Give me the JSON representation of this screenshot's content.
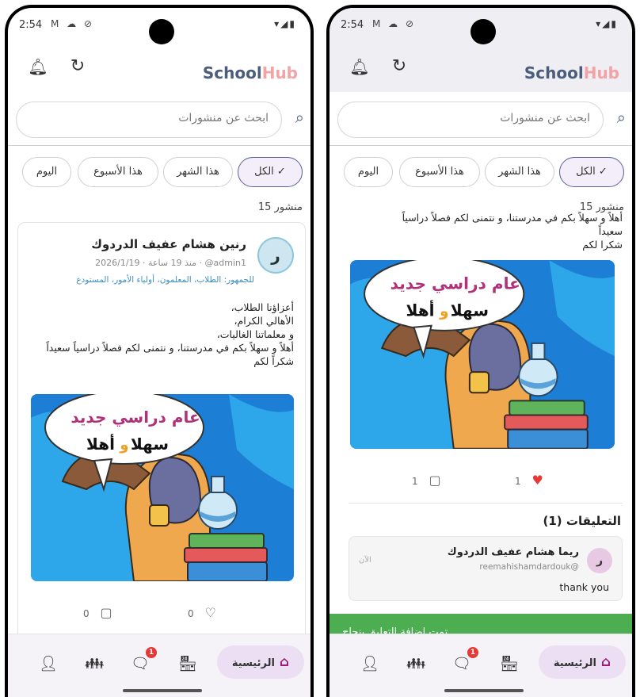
{
  "status_bar": {
    "time": "2:54",
    "left_icons": "M ☁ ⊘",
    "right_icons": "▾◢▮"
  },
  "header": {
    "brand_part1": "School",
    "brand_part2": "Hub"
  },
  "search": {
    "placeholder": "ابحث عن منشورات"
  },
  "filters": {
    "all": "الكل ✓",
    "month": "هذا الشهر",
    "week": "هذا الأسبوع",
    "today": "اليوم"
  },
  "post_count": "منشور 15",
  "post": {
    "avatar_letter": "ر",
    "author": "رنين هشام عفيف الدردوك",
    "meta": "admin1@ · منذ 19 ساعة · 2026/1/19",
    "audience": "للجمهور: الطلاب، المعلمون، أولياء الأمور، المستودع",
    "body_lines": [
      "أعزاؤنا الطلاب،",
      "الأهالي الكرام،",
      "و معلماتنا الغاليات،",
      "أهلاً و سهلاً بكم في مدرستنا، و نتمنى لكم فصلاً دراسياً سعيداً",
      "شكراً لكم"
    ],
    "image_title": "عام دراسي جديد",
    "image_greeting_1": "أهلا",
    "image_greeting_and": "و",
    "image_greeting_2": "سهلا",
    "comments_count_left": "0",
    "likes_count_left": "0",
    "comments_count_right": "1",
    "likes_count_right": "1"
  },
  "right_screen": {
    "cut_text_line1": "أهلاً و سهلاً بكم في مدرستنا، و نتمنى لكم فصلاً دراسياً",
    "cut_text_line2": "سعيداً",
    "cut_text_line3": "شكرا لكم",
    "comments_title": "التعليقات (1)",
    "comment": {
      "avatar_letter": "ر",
      "name": "ريما هشام عفيف الدردوك",
      "username": "reemahishamdardouk@",
      "time": "الآن",
      "text": "thank you"
    },
    "toast": "تمت إضافة التعليق بنجاح"
  },
  "bottom_nav": {
    "home_label": "الرئيسية",
    "badge": "1"
  },
  "colors": {
    "brand_dark": "#4a5d7c",
    "brand_pink": "#f2a3a5",
    "accent": "#9a1a7d",
    "toast_green": "#4cae50"
  }
}
